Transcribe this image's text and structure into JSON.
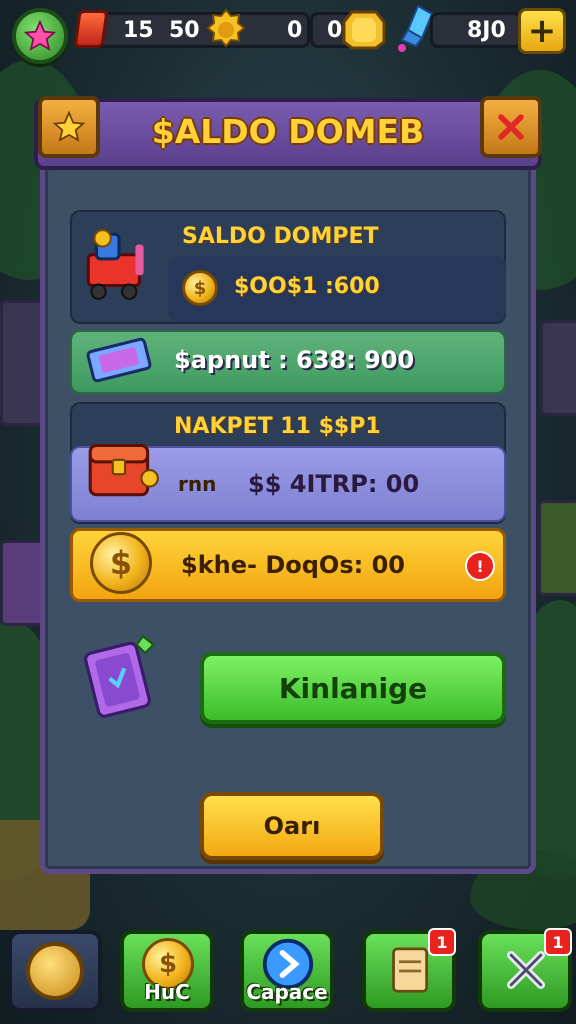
{
  "topbar": {
    "resource_a": "15",
    "resource_b": "50",
    "resource_c": "0",
    "resource_d": "0",
    "resource_e": "8Ј0",
    "plus_label": "+"
  },
  "panel": {
    "title": "$ALDO DOMEB",
    "wallet": {
      "title": "SALDO DOMPET",
      "amount": "$OO$1 :600"
    },
    "green_row": {
      "text": "$apnut : 638: 900"
    },
    "section": {
      "title": "NAKPET 11 $$P1"
    },
    "lavender_row": {
      "prefix": "rnn",
      "text": "$$ 4ITRP: 00"
    },
    "yellow_row": {
      "text": "$khe- DoqOs: 00",
      "badge": "!"
    },
    "primary_button": "Kinlanige",
    "secondary_button": "Oarı"
  },
  "bottom_nav": {
    "item1_label": "HuC",
    "item2_label": "Capace",
    "item3_badge": "1",
    "item4_badge": "1"
  },
  "colors": {
    "panel_bg": "#3e5066",
    "panel_border": "#5b4a86",
    "title_gold": "#ffd23a",
    "green_button": "#3cbd2a",
    "yellow_button": "#f2a812",
    "badge_red": "#e8231e"
  },
  "icons": {
    "top_left": "star-icon",
    "close": "close-icon",
    "favorite": "star-icon",
    "coin": "coin-icon",
    "chest": "chest-icon",
    "card": "card-icon",
    "cart": "cart-icon",
    "ticket": "ticket-icon",
    "crystal": "crystal-icon"
  }
}
